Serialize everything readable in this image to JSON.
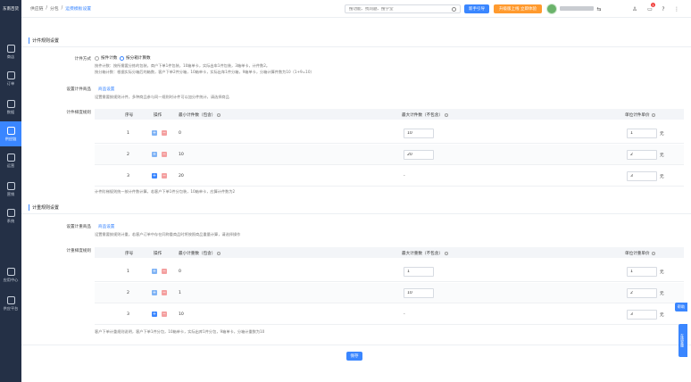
{
  "sidebar": {
    "logo": "东南百货",
    "items": [
      {
        "label": "商店",
        "icon": "shop-icon"
      },
      {
        "label": "订单",
        "icon": "order-icon"
      },
      {
        "label": "数据",
        "icon": "chart-icon"
      },
      {
        "label": "供应链",
        "icon": "supply-icon",
        "active": true
      },
      {
        "label": "运营",
        "icon": "puzzle-icon"
      },
      {
        "label": "营销",
        "icon": "tag-icon"
      },
      {
        "label": "系统",
        "icon": "gear-icon"
      },
      {
        "label": "应用中心",
        "icon": "apps-icon"
      },
      {
        "label": "供应平台",
        "icon": "platform-icon"
      }
    ]
  },
  "header": {
    "breadcrumb": [
      "供应链",
      "分包",
      "运费模板设置"
    ],
    "search_placeholder": "搜功能、找问题、搜学堂",
    "btn_blue": "新手引导",
    "btn_orange": "升级版上线 立即体验",
    "bell_count": "1"
  },
  "section1": {
    "title": "计件规则设置",
    "method_label": "计件方式",
    "radio1": "按件计数",
    "radio2": "按分箱计算数",
    "desc1": "按件计数：按所需要分拣的包装，商户下单1件包装，10箱单卡，实际出车1件包装，3箱单卡，计件数2。",
    "desc2": "按分箱计数：根据实际分箱后的箱数，客户下单2件分箱，10箱单卡，实际出车1件分箱，9箱单卡，分箱计算件数为10（1+9=10）",
    "goods_label": "设置计件商品",
    "goods_link": "商品设置",
    "goods_desc": "设置需要按规则计件，多种商品参与同一规则时计件可以加分件统计，请选择商品",
    "rule_label": "计件梯度规则",
    "headers": [
      "序号",
      "操作",
      "最小计件数（包含）",
      "最大计件数（不包含）",
      "单位计件单价"
    ],
    "rows": [
      {
        "no": "1",
        "min": "0",
        "max": "10",
        "price": "1",
        "unit": "元"
      },
      {
        "no": "2",
        "min": "10",
        "max": "20",
        "price": "2",
        "unit": "元"
      },
      {
        "no": "3",
        "min": "20",
        "max": "-",
        "price": "3",
        "unit": "元"
      }
    ],
    "footnote": "计件阶梯规则统一按计件数计算，若客户下单1件分包装，10箱单卡，应算计件数为2"
  },
  "section2": {
    "title": "计重规则设置",
    "goods_label": "设置计重商品",
    "goods_link": "商品设置",
    "goods_desc": "设置需要按规则计重，若客户订单中存在同称重商品时将按照商品重量计算，请选择操作",
    "rule_label": "计重梯度规则",
    "headers": [
      "序号",
      "操作",
      "最小计重数（包含）",
      "最大计重数（不包含）",
      "单位计重单价"
    ],
    "rows": [
      {
        "no": "1",
        "min": "0",
        "max": "1",
        "price": "1",
        "unit": "元"
      },
      {
        "no": "2",
        "min": "1",
        "max": "10",
        "price": "2",
        "unit": "元"
      },
      {
        "no": "3",
        "min": "10",
        "max": "-",
        "price": "3",
        "unit": "元"
      }
    ],
    "footnote": "客户下单计重规则说明，客户下单1件分包，10箱单卡，实际出库1件分包，9箱单卡，分箱计重数为10"
  },
  "save_label": "保存",
  "float_help": "帮助",
  "float_side": "在线客服"
}
